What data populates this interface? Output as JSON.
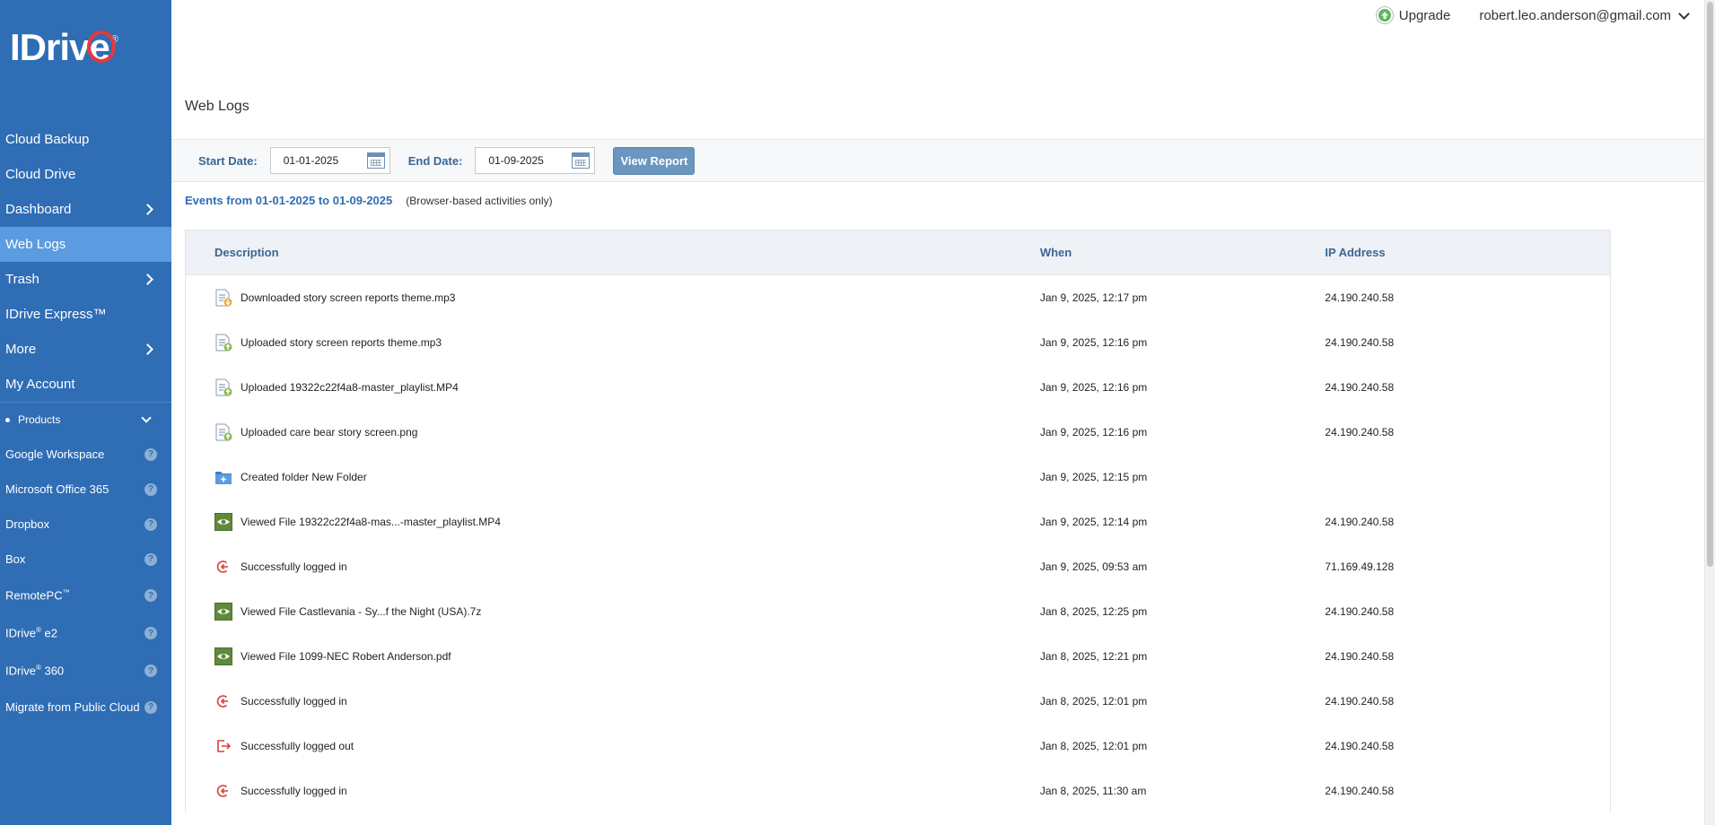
{
  "brand": {
    "logo_text": "IDriv",
    "logo_e": "e",
    "logo_reg": "®"
  },
  "topbar": {
    "upgrade": "Upgrade",
    "account": "robert.leo.anderson@gmail.com"
  },
  "sidebar": {
    "items": [
      {
        "label": "Cloud Backup",
        "chevron": false,
        "active": false
      },
      {
        "label": "Cloud Drive",
        "chevron": false,
        "active": false
      },
      {
        "label": "Dashboard",
        "chevron": true,
        "active": false
      },
      {
        "label": "Web Logs",
        "chevron": false,
        "active": true
      },
      {
        "label": "Trash",
        "chevron": true,
        "active": false
      },
      {
        "label": "IDrive Express™",
        "chevron": false,
        "active": false
      },
      {
        "label": "More",
        "chevron": true,
        "active": false
      },
      {
        "label": "My Account",
        "chevron": false,
        "active": false
      }
    ],
    "products_label": "Products",
    "products": [
      {
        "label": "Google Workspace"
      },
      {
        "label": "Microsoft Office 365"
      },
      {
        "label": "Dropbox"
      },
      {
        "label": "Box"
      },
      {
        "label": "RemotePC",
        "sup": "™"
      },
      {
        "label": "IDrive",
        "sup": "®",
        "suffix": " e2"
      },
      {
        "label": "IDrive",
        "sup": "®",
        "suffix": " 360"
      },
      {
        "label": "Migrate from Public Cloud"
      }
    ],
    "help_glyph": "?"
  },
  "page": {
    "title": "Web Logs"
  },
  "filters": {
    "start_label": "Start Date:",
    "start_value": "01-01-2025",
    "end_label": "End Date:",
    "end_value": "01-09-2025",
    "view_button": "View Report"
  },
  "events": {
    "range": "Events from 01-01-2025 to 01-09-2025",
    "note": "(Browser-based activities only)"
  },
  "table": {
    "headers": {
      "description": "Description",
      "when": "When",
      "ip": "IP Address"
    },
    "rows": [
      {
        "icon": "download",
        "description": "Downloaded story screen reports theme.mp3",
        "when": "Jan 9, 2025, 12:17 pm",
        "ip": "24.190.240.58"
      },
      {
        "icon": "upload",
        "description": "Uploaded story screen reports theme.mp3",
        "when": "Jan 9, 2025, 12:16 pm",
        "ip": "24.190.240.58"
      },
      {
        "icon": "upload",
        "description": "Uploaded 19322c22f4a8-master_playlist.MP4",
        "when": "Jan 9, 2025, 12:16 pm",
        "ip": "24.190.240.58"
      },
      {
        "icon": "upload",
        "description": "Uploaded care bear story screen.png",
        "when": "Jan 9, 2025, 12:16 pm",
        "ip": "24.190.240.58"
      },
      {
        "icon": "folder",
        "description": "Created folder New Folder",
        "when": "Jan 9, 2025, 12:15 pm",
        "ip": ""
      },
      {
        "icon": "view",
        "description": "Viewed File 19322c22f4a8-mas...-master_playlist.MP4",
        "when": "Jan 9, 2025, 12:14 pm",
        "ip": "24.190.240.58"
      },
      {
        "icon": "login",
        "description": "Successfully logged in",
        "when": "Jan 9, 2025, 09:53 am",
        "ip": "71.169.49.128"
      },
      {
        "icon": "view",
        "description": "Viewed File Castlevania - Sy...f the Night (USA).7z",
        "when": "Jan 8, 2025, 12:25 pm",
        "ip": "24.190.240.58"
      },
      {
        "icon": "view",
        "description": "Viewed File 1099-NEC Robert Anderson.pdf",
        "when": "Jan 8, 2025, 12:21 pm",
        "ip": "24.190.240.58"
      },
      {
        "icon": "login",
        "description": "Successfully logged in",
        "when": "Jan 8, 2025, 12:01 pm",
        "ip": "24.190.240.58"
      },
      {
        "icon": "logout",
        "description": "Successfully logged out",
        "when": "Jan 8, 2025, 12:01 pm",
        "ip": "24.190.240.58"
      },
      {
        "icon": "login",
        "description": "Successfully logged in",
        "when": "Jan 8, 2025, 11:30 am",
        "ip": "24.190.240.58"
      }
    ]
  },
  "colors": {
    "sidebar": "#2f6db5",
    "active": "#5b9be0",
    "accent": "#3b6694",
    "button": "#6a96bf"
  }
}
